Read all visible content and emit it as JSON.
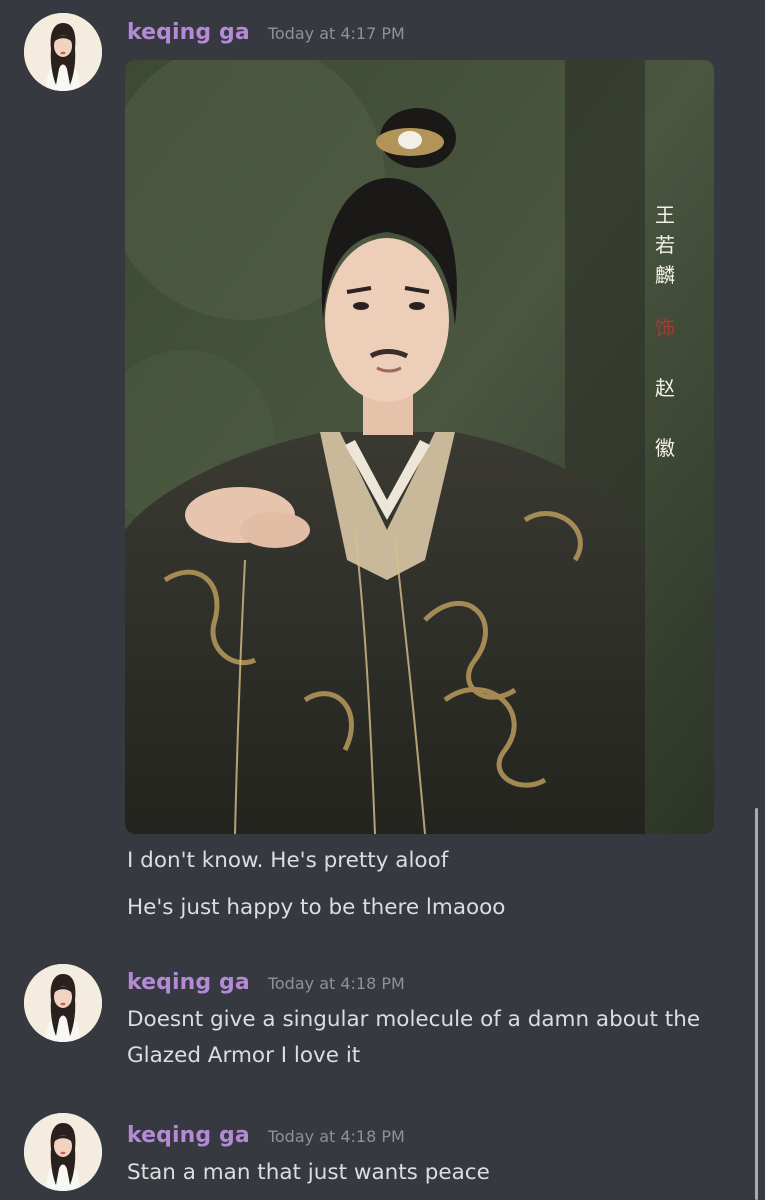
{
  "messages": [
    {
      "username": "keqing ga",
      "timestamp": "Today at 4:17 PM",
      "attachment": {
        "type": "image",
        "caption_vertical": "王若麟饰赵徽"
      },
      "lines": [
        "I don't know. He's pretty aloof",
        "He's just happy to be there lmaooo"
      ]
    },
    {
      "username": "keqing ga",
      "timestamp": "Today at 4:18 PM",
      "lines": [
        "Doesnt give a singular molecule of a damn about the Glazed Armor I love it"
      ]
    },
    {
      "username": "keqing ga",
      "timestamp": "Today at 4:18 PM",
      "lines": [
        "Stan a man that just wants peace"
      ]
    }
  ],
  "colors": {
    "background": "#36393f",
    "username": "#b48ad6",
    "timestamp": "#8e9297",
    "text": "#dcddde"
  }
}
